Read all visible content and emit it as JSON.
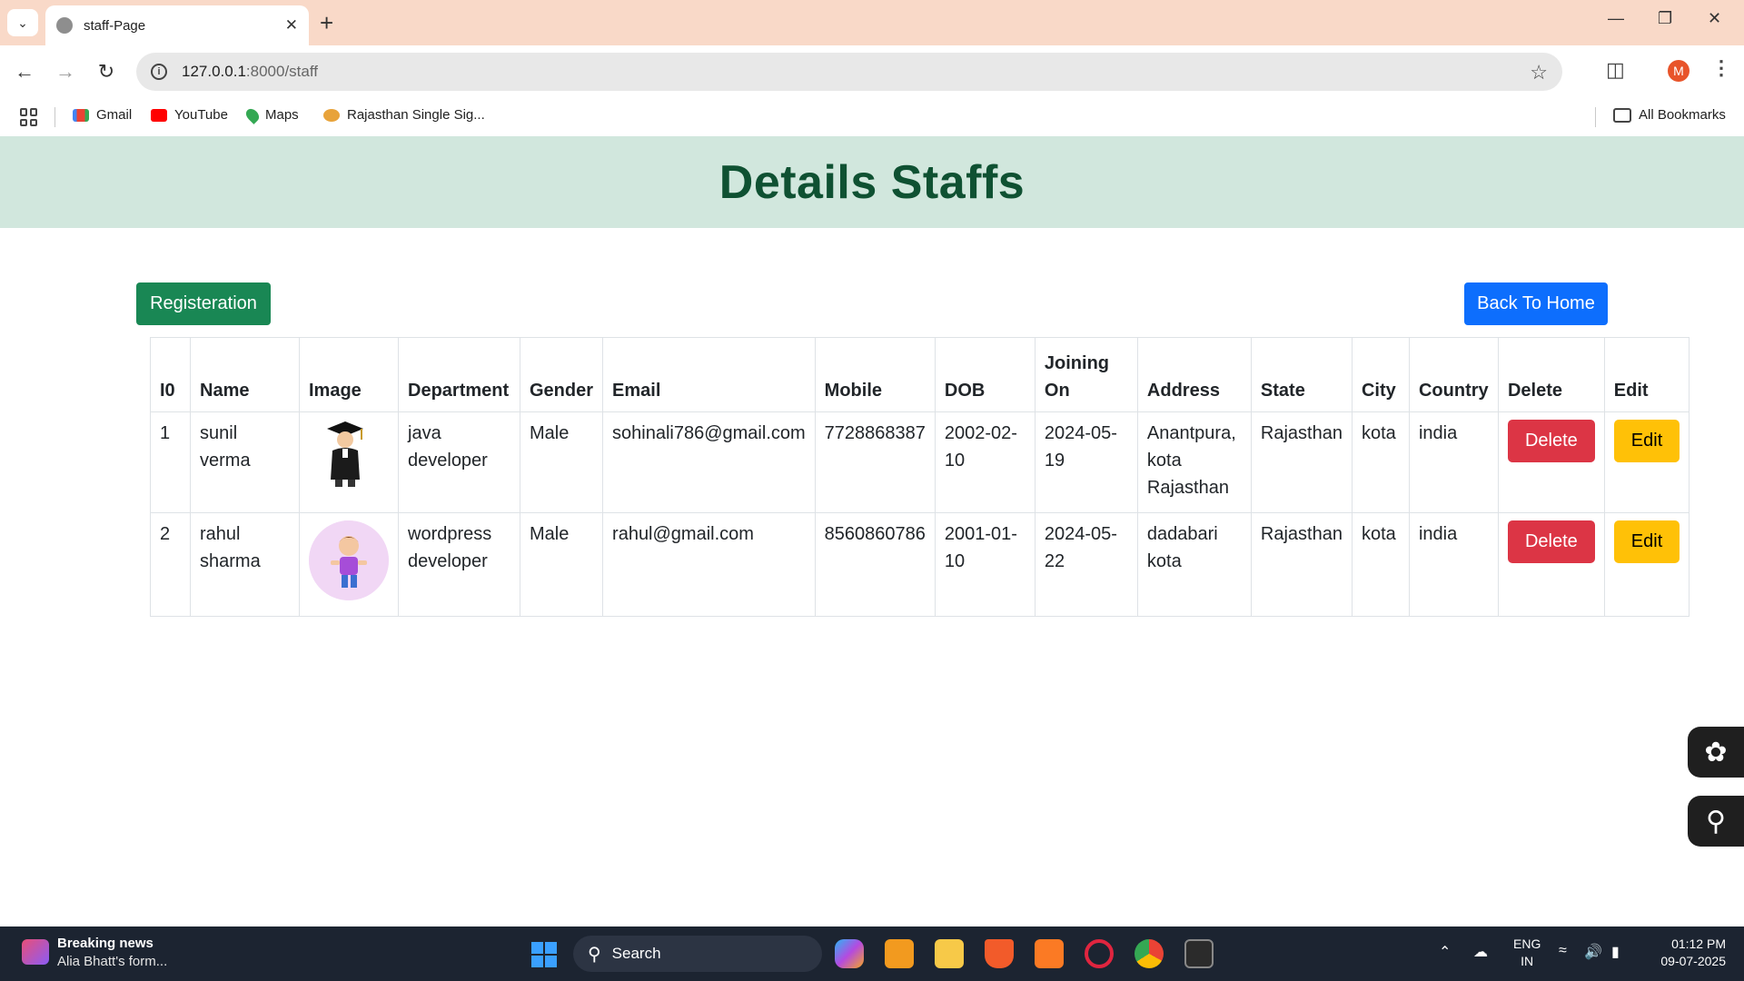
{
  "browser": {
    "tab_title": "staff-Page",
    "url_host": "127.0.0.1",
    "url_path": ":8000/staff",
    "avatar_letter": "M",
    "bookmarks": [
      "Gmail",
      "YouTube",
      "Maps",
      "Rajasthan Single Sig..."
    ],
    "all_bookmarks": "All Bookmarks"
  },
  "page": {
    "heading": "Details Staffs",
    "register_label": "Registeration",
    "home_label": "Back To Home"
  },
  "table": {
    "headers": [
      "I0",
      "Name",
      "Image",
      "Department",
      "Gender",
      "Email",
      "Mobile",
      "DOB",
      "Joining On",
      "Address",
      "State",
      "City",
      "Country",
      "Delete",
      "Edit"
    ],
    "rows": [
      {
        "id": "1",
        "name": "sunil verma",
        "department": "java developer",
        "gender": "Male",
        "email": "sohinali786@gmail.com",
        "mobile": "7728868387",
        "dob": "2002-02-10",
        "joining": "2024-05-19",
        "address": "Anantpura, kota Rajasthan",
        "state": "Rajasthan",
        "city": "kota",
        "country": "india",
        "delete_label": "Delete",
        "edit_label": "Edit"
      },
      {
        "id": "2",
        "name": "rahul sharma",
        "department": "wordpress developer",
        "gender": "Male",
        "email": "rahul@gmail.com",
        "mobile": "8560860786",
        "dob": "2001-01-10",
        "joining": "2024-05-22",
        "address": "dadabari kota",
        "state": "Rajasthan",
        "city": "kota",
        "country": "india",
        "delete_label": "Delete",
        "edit_label": "Edit"
      }
    ]
  },
  "taskbar": {
    "news_title": "Breaking news",
    "news_sub": "Alia Bhatt's form...",
    "search_label": "Search",
    "lang_top": "ENG",
    "lang_bottom": "IN",
    "time": "01:12 PM",
    "date": "09-07-2025"
  },
  "colors": {
    "header_bg": "#d1e7dd",
    "header_text": "#0f5132",
    "register_btn": "#198754",
    "home_btn": "#0d6efd",
    "delete_btn": "#dc3545",
    "edit_btn": "#ffc107",
    "tabstrip": "#f9d9c8"
  }
}
